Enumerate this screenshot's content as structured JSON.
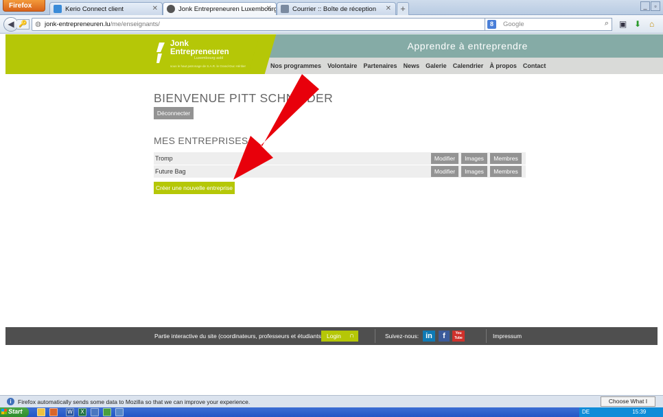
{
  "browser": {
    "menu_label": "Firefox",
    "tabs": [
      {
        "title": "Kerio Connect client"
      },
      {
        "title": "Jonk Entrepreneuren Luxembourg asbl | ..."
      },
      {
        "title": "Courrier :: Boîte de réception"
      }
    ],
    "new_tab": "+",
    "url_host": "jonk-entrepreneuren.lu",
    "url_path": "/me/enseignants/",
    "search_placeholder": "Google",
    "search_engine": "8"
  },
  "site": {
    "logo_line1": "Jonk",
    "logo_line2": "Entrepreneuren",
    "logo_sub": "Luxembourg asbl",
    "logo_tag": "sous le haut patronage de S.A.R. le Grand-Duc Héritier",
    "tagline": "Apprendre à entreprendre",
    "nav": [
      "Nos programmes",
      "Volontaire",
      "Partenaires",
      "News",
      "Galerie",
      "Calendrier",
      "À propos",
      "Contact"
    ],
    "welcome": "BIENVENUE PITT SCHNEIDER",
    "logout": "Déconnecter",
    "companies_heading": "MES ENTREPRISES",
    "companies": [
      {
        "name": "Tromp",
        "edit": "Modifier",
        "images": "Images",
        "members": "Membres"
      },
      {
        "name": "Future Bag",
        "edit": "Modifier",
        "images": "Images",
        "members": "Membres"
      }
    ],
    "create_button": "Créer une nouvelle entreprise",
    "footer": {
      "interactive_text": "Partie interactive du site (coordinateurs, professeurs et étudiants):",
      "login": "Login",
      "follow": "Suivez-nous:",
      "social": [
        "in",
        "f",
        "You Tube"
      ],
      "impressum": "Impressum"
    }
  },
  "notification": {
    "text": "Firefox automatically sends some data to Mozilla so that we can improve your experience.",
    "button": "Choose What I Share"
  },
  "taskbar": {
    "start": "Start",
    "tray_lang": "DE",
    "tray_time": "15:39"
  },
  "colors": {
    "brand_green": "#b5c707",
    "banner_teal": "#85aba6",
    "button_gray": "#939393",
    "arrow_red": "#e8000b"
  }
}
